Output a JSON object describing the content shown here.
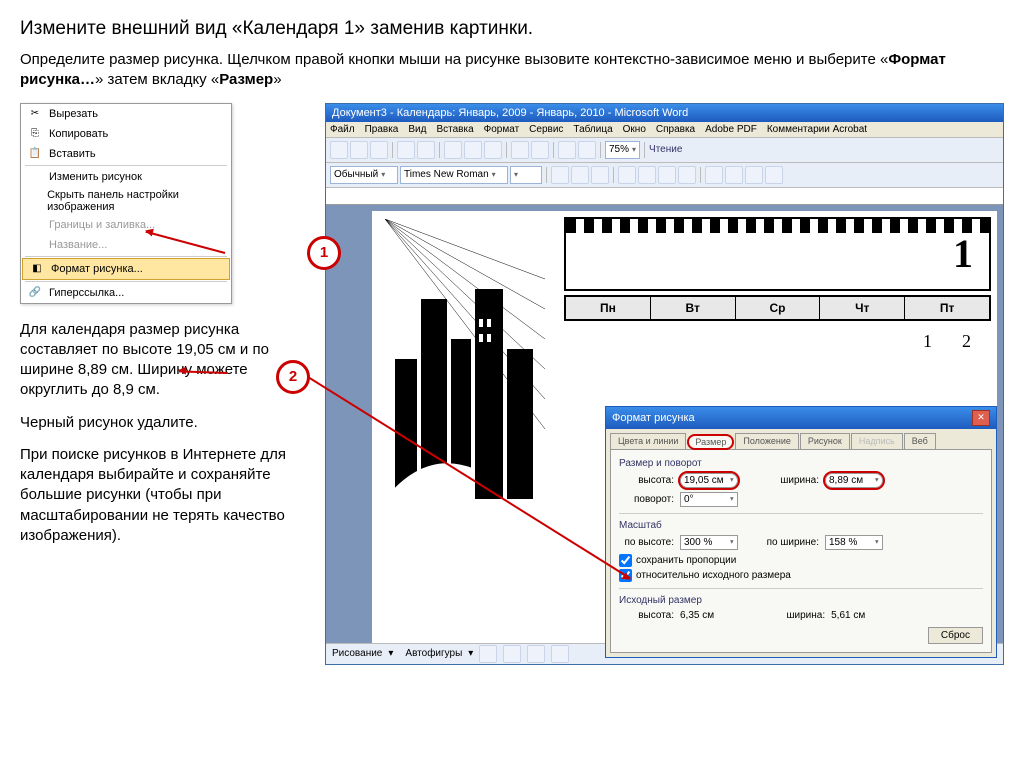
{
  "heading": "Измените внешний вид «Календаря 1» заменив картинки.",
  "intro_pre": "Определите размер рисунка. Щелчком правой кнопки мыши на рисунке вызовите контекстно-зависимое меню и выберите «",
  "intro_b1": "Формат рисунка…",
  "intro_mid": "» затем вкладку «",
  "intro_b2": "Размер",
  "intro_post": "»",
  "ctx": {
    "cut": "Вырезать",
    "copy": "Копировать",
    "paste": "Вставить",
    "edit": "Изменить рисунок",
    "hide": "Скрыть панель настройки изображения",
    "border": "Границы и заливка...",
    "caption": "Название...",
    "format": "Формат рисунка...",
    "link": "Гиперссылка..."
  },
  "marker1": "1",
  "marker2": "2",
  "para1": "Для календаря размер рисунка составляет по высоте 19,05 см и по ширине 8,89 см. Ширину можете округлить до 8,9 см.",
  "para2": "Черный рисунок удалите.",
  "para3": "При поиске рисунков в Интернете для календаря выбирайте и сохраняйте большие рисунки (чтобы при масштабировании не терять качество изображения).",
  "word": {
    "title": "Документ3 - Календарь: Январь, 2009 - Январь, 2010 - Microsoft Word",
    "menu": {
      "file": "Файл",
      "edit": "Правка",
      "view": "Вид",
      "insert": "Вставка",
      "format": "Формат",
      "tools": "Сервис",
      "table": "Таблица",
      "window": "Окно",
      "help": "Справка",
      "adobe": "Adobe PDF",
      "acrobat": "Комментарии Acrobat"
    },
    "style": "Обычный",
    "font": "Times New Roman",
    "zoom": "75%",
    "read": "Чтение",
    "status": {
      "draw": "Рисование",
      "shapes": "Автофигуры"
    }
  },
  "cal": {
    "big": "1",
    "days": [
      "Пн",
      "Вт",
      "Ср",
      "Чт",
      "Пт"
    ],
    "n1": "1",
    "n2": "2"
  },
  "dlg": {
    "title": "Формат рисунка",
    "tabs": {
      "colors": "Цвета и линии",
      "size": "Размер",
      "pos": "Положение",
      "pic": "Рисунок",
      "txt": "Надпись",
      "web": "Веб"
    },
    "grp1": "Размер и поворот",
    "height_l": "высота:",
    "height_v": "19,05 см",
    "width_l": "ширина:",
    "width_v": "8,89 см",
    "rotate_l": "поворот:",
    "rotate_v": "0°",
    "grp2": "Масштаб",
    "sheight_l": "по высоте:",
    "sheight_v": "300 %",
    "swidth_l": "по ширине:",
    "swidth_v": "158 %",
    "chk1": "сохранить пропорции",
    "chk2": "относительно исходного размера",
    "grp3": "Исходный размер",
    "oheight_l": "высота:",
    "oheight_v": "6,35 см",
    "owidth_l": "ширина:",
    "owidth_v": "5,61 см",
    "reset": "Сброс"
  }
}
